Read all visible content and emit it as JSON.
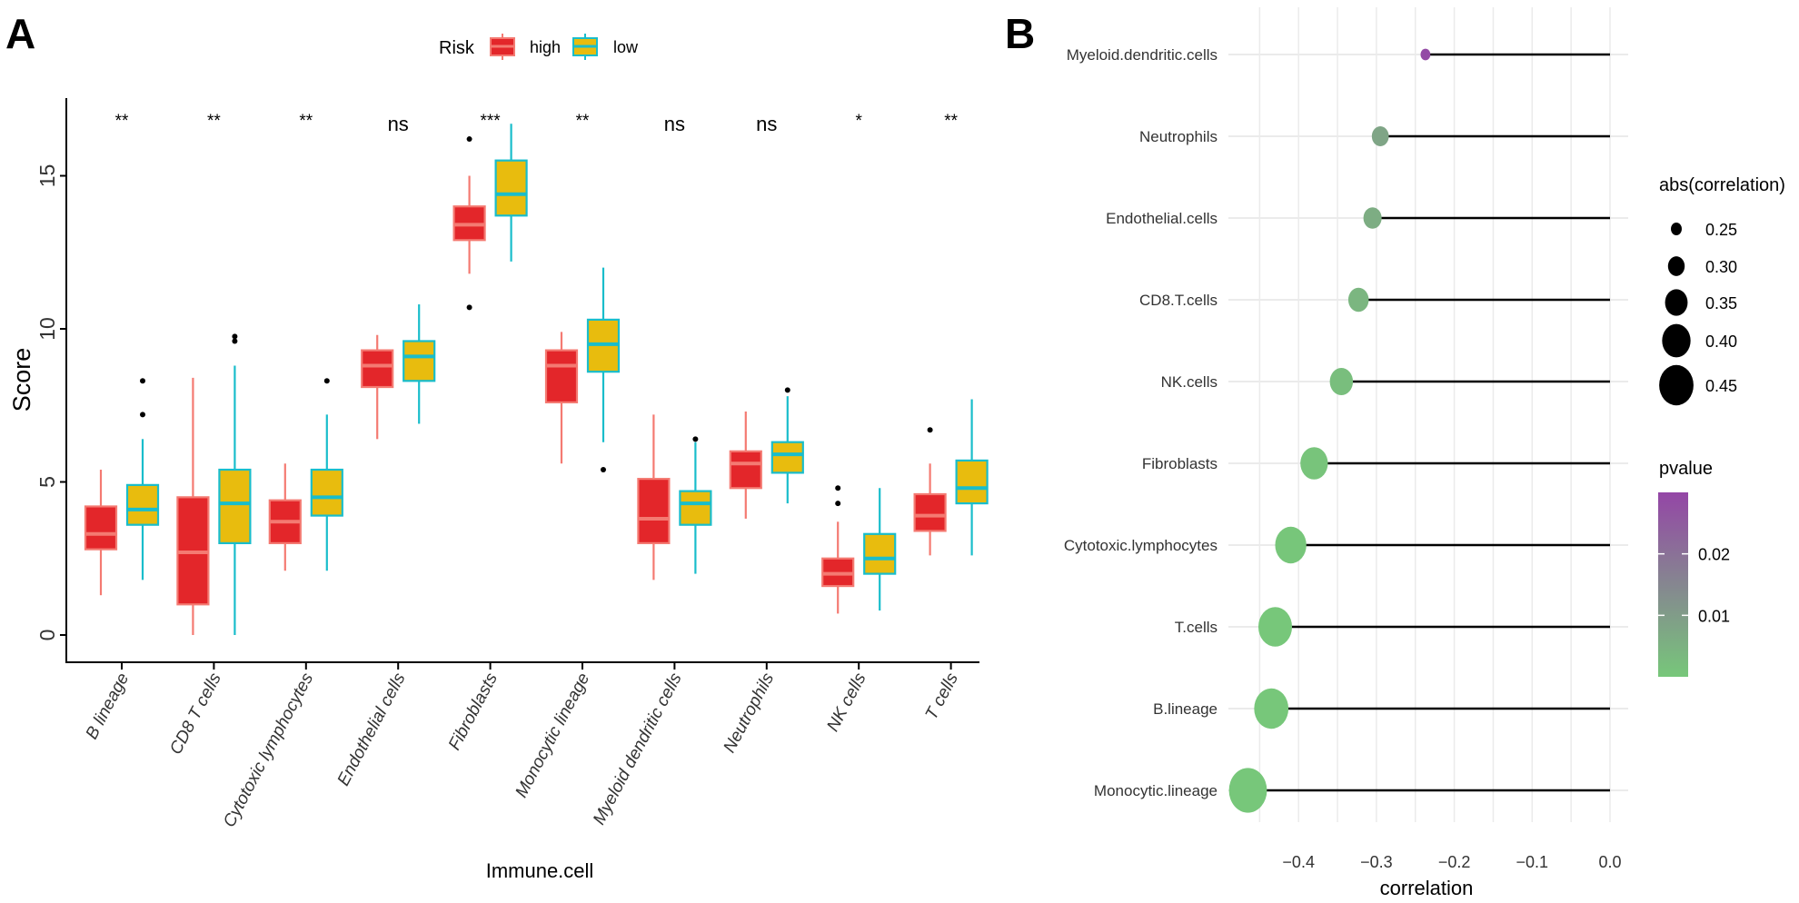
{
  "figure": {
    "panel_a_letter": "A",
    "panel_b_letter": "B"
  },
  "chart_data": [
    {
      "type": "box",
      "panel": "A",
      "xlabel": "Immune.cell",
      "ylabel": "Score",
      "ylim": [
        -0.6,
        17.3
      ],
      "yticks": [
        0,
        5,
        10,
        15
      ],
      "grid": false,
      "legend": {
        "title": "Risk",
        "position": "top",
        "entries": [
          {
            "name": "high",
            "fill": "#E3262A",
            "stroke": "#F47A72"
          },
          {
            "name": "low",
            "fill": "#E8BC0E",
            "stroke": "#19BDCB"
          }
        ]
      },
      "categories": [
        "B lineage",
        "CD8 T cells",
        "Cytotoxic lymphocytes",
        "Endothelial cells",
        "Fibroblasts",
        "Monocytic lineage",
        "Myeloid dendritic cells",
        "Neutrophils",
        "NK cells",
        "T cells"
      ],
      "significance": [
        "**",
        "**",
        "**",
        "ns",
        "***",
        "**",
        "ns",
        "ns",
        "*",
        "**"
      ],
      "series": [
        {
          "name": "high",
          "boxes": [
            {
              "min": 1.3,
              "q1": 2.8,
              "median": 3.3,
              "q3": 4.2,
              "max": 5.4,
              "outliers": []
            },
            {
              "min": 0.0,
              "q1": 1.0,
              "median": 2.7,
              "q3": 4.5,
              "max": 8.4,
              "outliers": []
            },
            {
              "min": 2.1,
              "q1": 3.0,
              "median": 3.7,
              "q3": 4.4,
              "max": 5.6,
              "outliers": []
            },
            {
              "min": 6.4,
              "q1": 8.1,
              "median": 8.8,
              "q3": 9.3,
              "max": 9.8,
              "outliers": []
            },
            {
              "min": 11.8,
              "q1": 12.9,
              "median": 13.4,
              "q3": 14.0,
              "max": 15.0,
              "outliers": [
                16.2,
                10.7
              ]
            },
            {
              "min": 5.6,
              "q1": 7.6,
              "median": 8.8,
              "q3": 9.3,
              "max": 9.9,
              "outliers": []
            },
            {
              "min": 1.8,
              "q1": 3.0,
              "median": 3.8,
              "q3": 5.1,
              "max": 7.2,
              "outliers": []
            },
            {
              "min": 3.8,
              "q1": 4.8,
              "median": 5.6,
              "q3": 6.0,
              "max": 7.3,
              "outliers": []
            },
            {
              "min": 0.7,
              "q1": 1.6,
              "median": 2.0,
              "q3": 2.5,
              "max": 3.7,
              "outliers": [
                4.3,
                4.8
              ]
            },
            {
              "min": 2.6,
              "q1": 3.4,
              "median": 3.9,
              "q3": 4.6,
              "max": 5.6,
              "outliers": [
                6.7
              ]
            }
          ]
        },
        {
          "name": "low",
          "boxes": [
            {
              "min": 1.8,
              "q1": 3.6,
              "median": 4.1,
              "q3": 4.9,
              "max": 6.4,
              "outliers": [
                7.2,
                8.3
              ]
            },
            {
              "min": 0.0,
              "q1": 3.0,
              "median": 4.3,
              "q3": 5.4,
              "max": 8.8,
              "outliers": [
                9.6,
                9.75
              ]
            },
            {
              "min": 2.1,
              "q1": 3.9,
              "median": 4.5,
              "q3": 5.4,
              "max": 7.2,
              "outliers": [
                8.3
              ]
            },
            {
              "min": 6.9,
              "q1": 8.3,
              "median": 9.1,
              "q3": 9.6,
              "max": 10.8,
              "outliers": []
            },
            {
              "min": 12.2,
              "q1": 13.7,
              "median": 14.4,
              "q3": 15.5,
              "max": 16.7,
              "outliers": []
            },
            {
              "min": 6.3,
              "q1": 8.6,
              "median": 9.5,
              "q3": 10.3,
              "max": 12.0,
              "outliers": [
                5.4
              ]
            },
            {
              "min": 2.0,
              "q1": 3.6,
              "median": 4.3,
              "q3": 4.7,
              "max": 6.3,
              "outliers": [
                6.4
              ]
            },
            {
              "min": 4.3,
              "q1": 5.3,
              "median": 5.9,
              "q3": 6.3,
              "max": 7.8,
              "outliers": [
                8.0
              ]
            },
            {
              "min": 0.8,
              "q1": 2.0,
              "median": 2.5,
              "q3": 3.3,
              "max": 4.8,
              "outliers": []
            },
            {
              "min": 2.6,
              "q1": 4.3,
              "median": 4.8,
              "q3": 5.7,
              "max": 7.7,
              "outliers": []
            }
          ]
        }
      ]
    },
    {
      "type": "lollipop",
      "panel": "B",
      "xlabel": "correlation",
      "ylabel": "",
      "xlim": [
        -0.48,
        0.015
      ],
      "xticks": [
        -0.4,
        -0.3,
        -0.2,
        -0.1,
        0.0
      ],
      "xtick_labels": [
        "−0.4",
        "−0.3",
        "−0.2",
        "−0.1",
        "0.0"
      ],
      "grid": true,
      "categories": [
        "Myeloid.dendritic.cells",
        "Neutrophils",
        "Endothelial.cells",
        "CD8.T.cells",
        "NK.cells",
        "Fibroblasts",
        "Cytotoxic.lymphocytes",
        "T.cells",
        "B.lineage",
        "Monocytic.lineage"
      ],
      "correlation": [
        -0.237,
        -0.295,
        -0.305,
        -0.323,
        -0.345,
        -0.38,
        -0.41,
        -0.43,
        -0.435,
        -0.465
      ],
      "pvalue": [
        0.029,
        0.008,
        0.006,
        0.004,
        0.002,
        0.0008,
        0.0003,
        0.0001,
        0.0001,
        5e-05
      ],
      "size_legend": {
        "title": "abs(correlation)",
        "position": "right",
        "values": [
          0.25,
          0.3,
          0.35,
          0.4,
          0.45
        ],
        "labels": [
          "0.25",
          "0.30",
          "0.35",
          "0.40",
          "0.45"
        ]
      },
      "color_legend": {
        "title": "pvalue",
        "position": "right",
        "range": [
          0.0,
          0.03
        ],
        "ticks": [
          0.02,
          0.01
        ],
        "tick_labels": [
          "0.02",
          "0.01"
        ],
        "low_color": "#77C77A",
        "high_color": "#9446A6"
      }
    }
  ]
}
